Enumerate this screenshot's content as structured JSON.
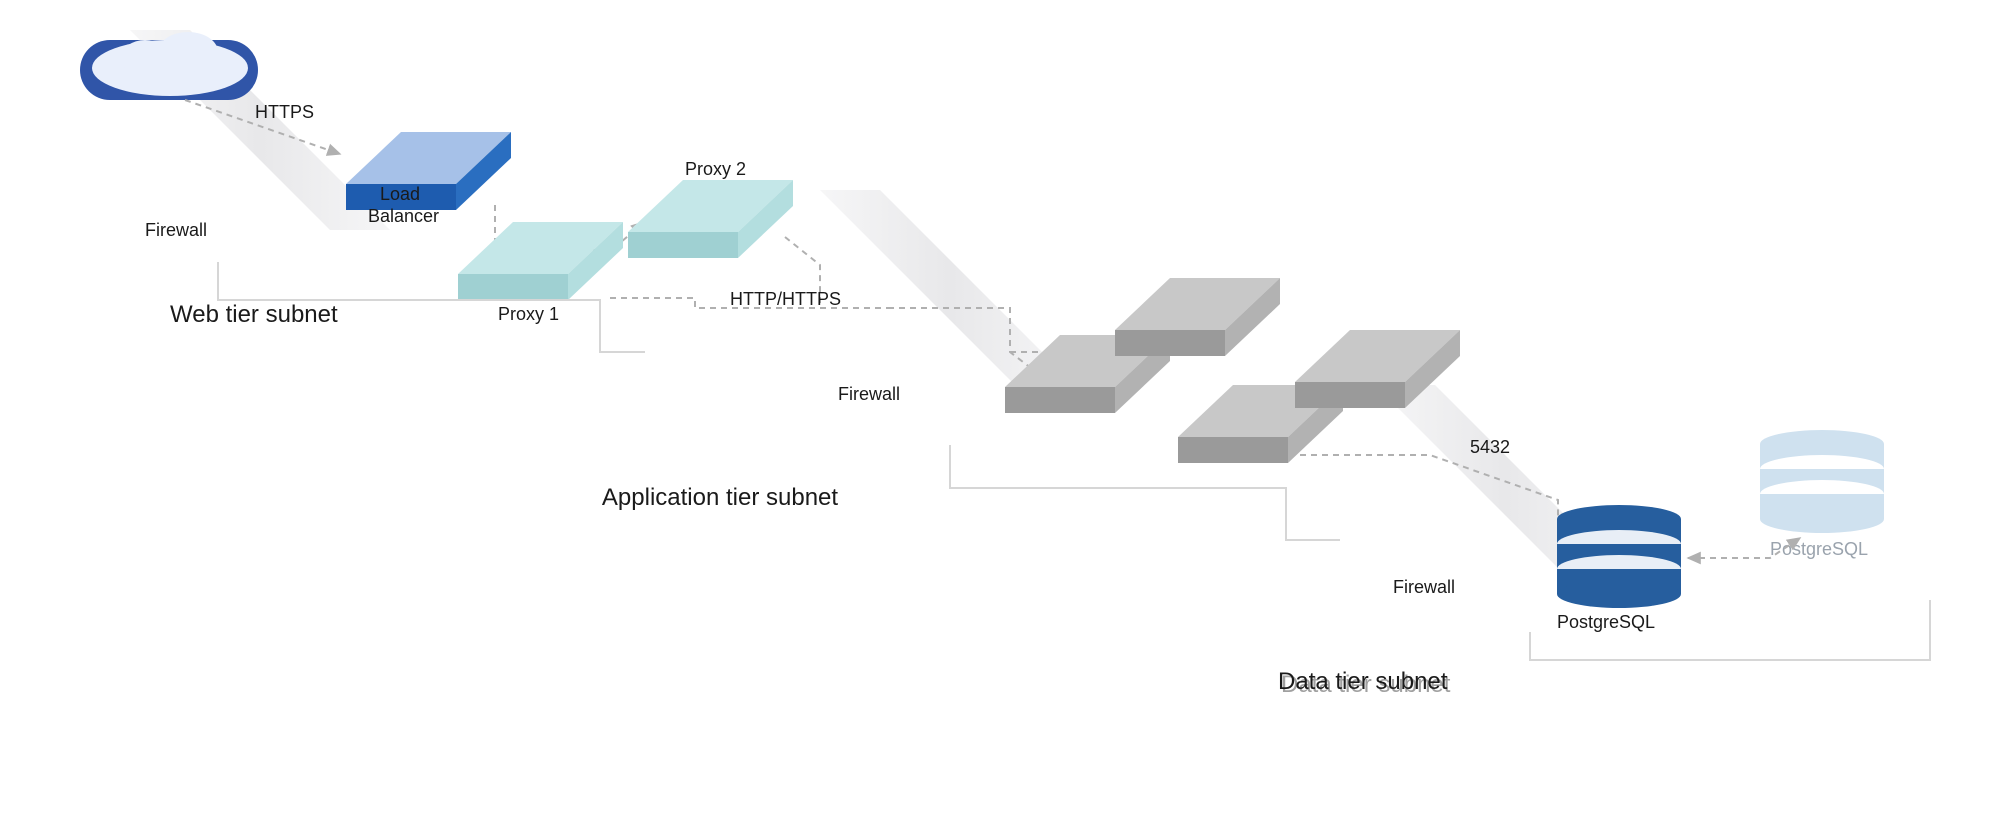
{
  "labels": {
    "cloud": "",
    "firewall1": "Firewall",
    "firewall2": "Firewall",
    "firewall3": "Firewall",
    "https": "HTTPS",
    "http_https": "HTTP/HTTPS",
    "port": "5432",
    "load_balancer_line1": "Load",
    "load_balancer_line2": "Balancer",
    "proxy1": "Proxy 1",
    "proxy2": "Proxy 2",
    "web_tier_band": "Web tier subnet",
    "app_tier_band": "Application tier subnet",
    "data_tier_band": "Data tier subnet",
    "postgres1": "PostgreSQL",
    "postgres2": "PostgreSQL"
  },
  "colors": {
    "cloud": "#3055a8",
    "lb_top": "#a6c1e8",
    "lb_side": "#1e5caf",
    "proxy_top": "#c4e7e8",
    "proxy_side": "#a8d5d7",
    "app_top": "#c8c8c8",
    "app_side": "#9e9e9e",
    "db_primary": "#265e9e",
    "db_secondary": "#cfe1ef",
    "wall": "#ebebec",
    "band": "#d6d6d6",
    "arrow": "#b0b0b0"
  }
}
